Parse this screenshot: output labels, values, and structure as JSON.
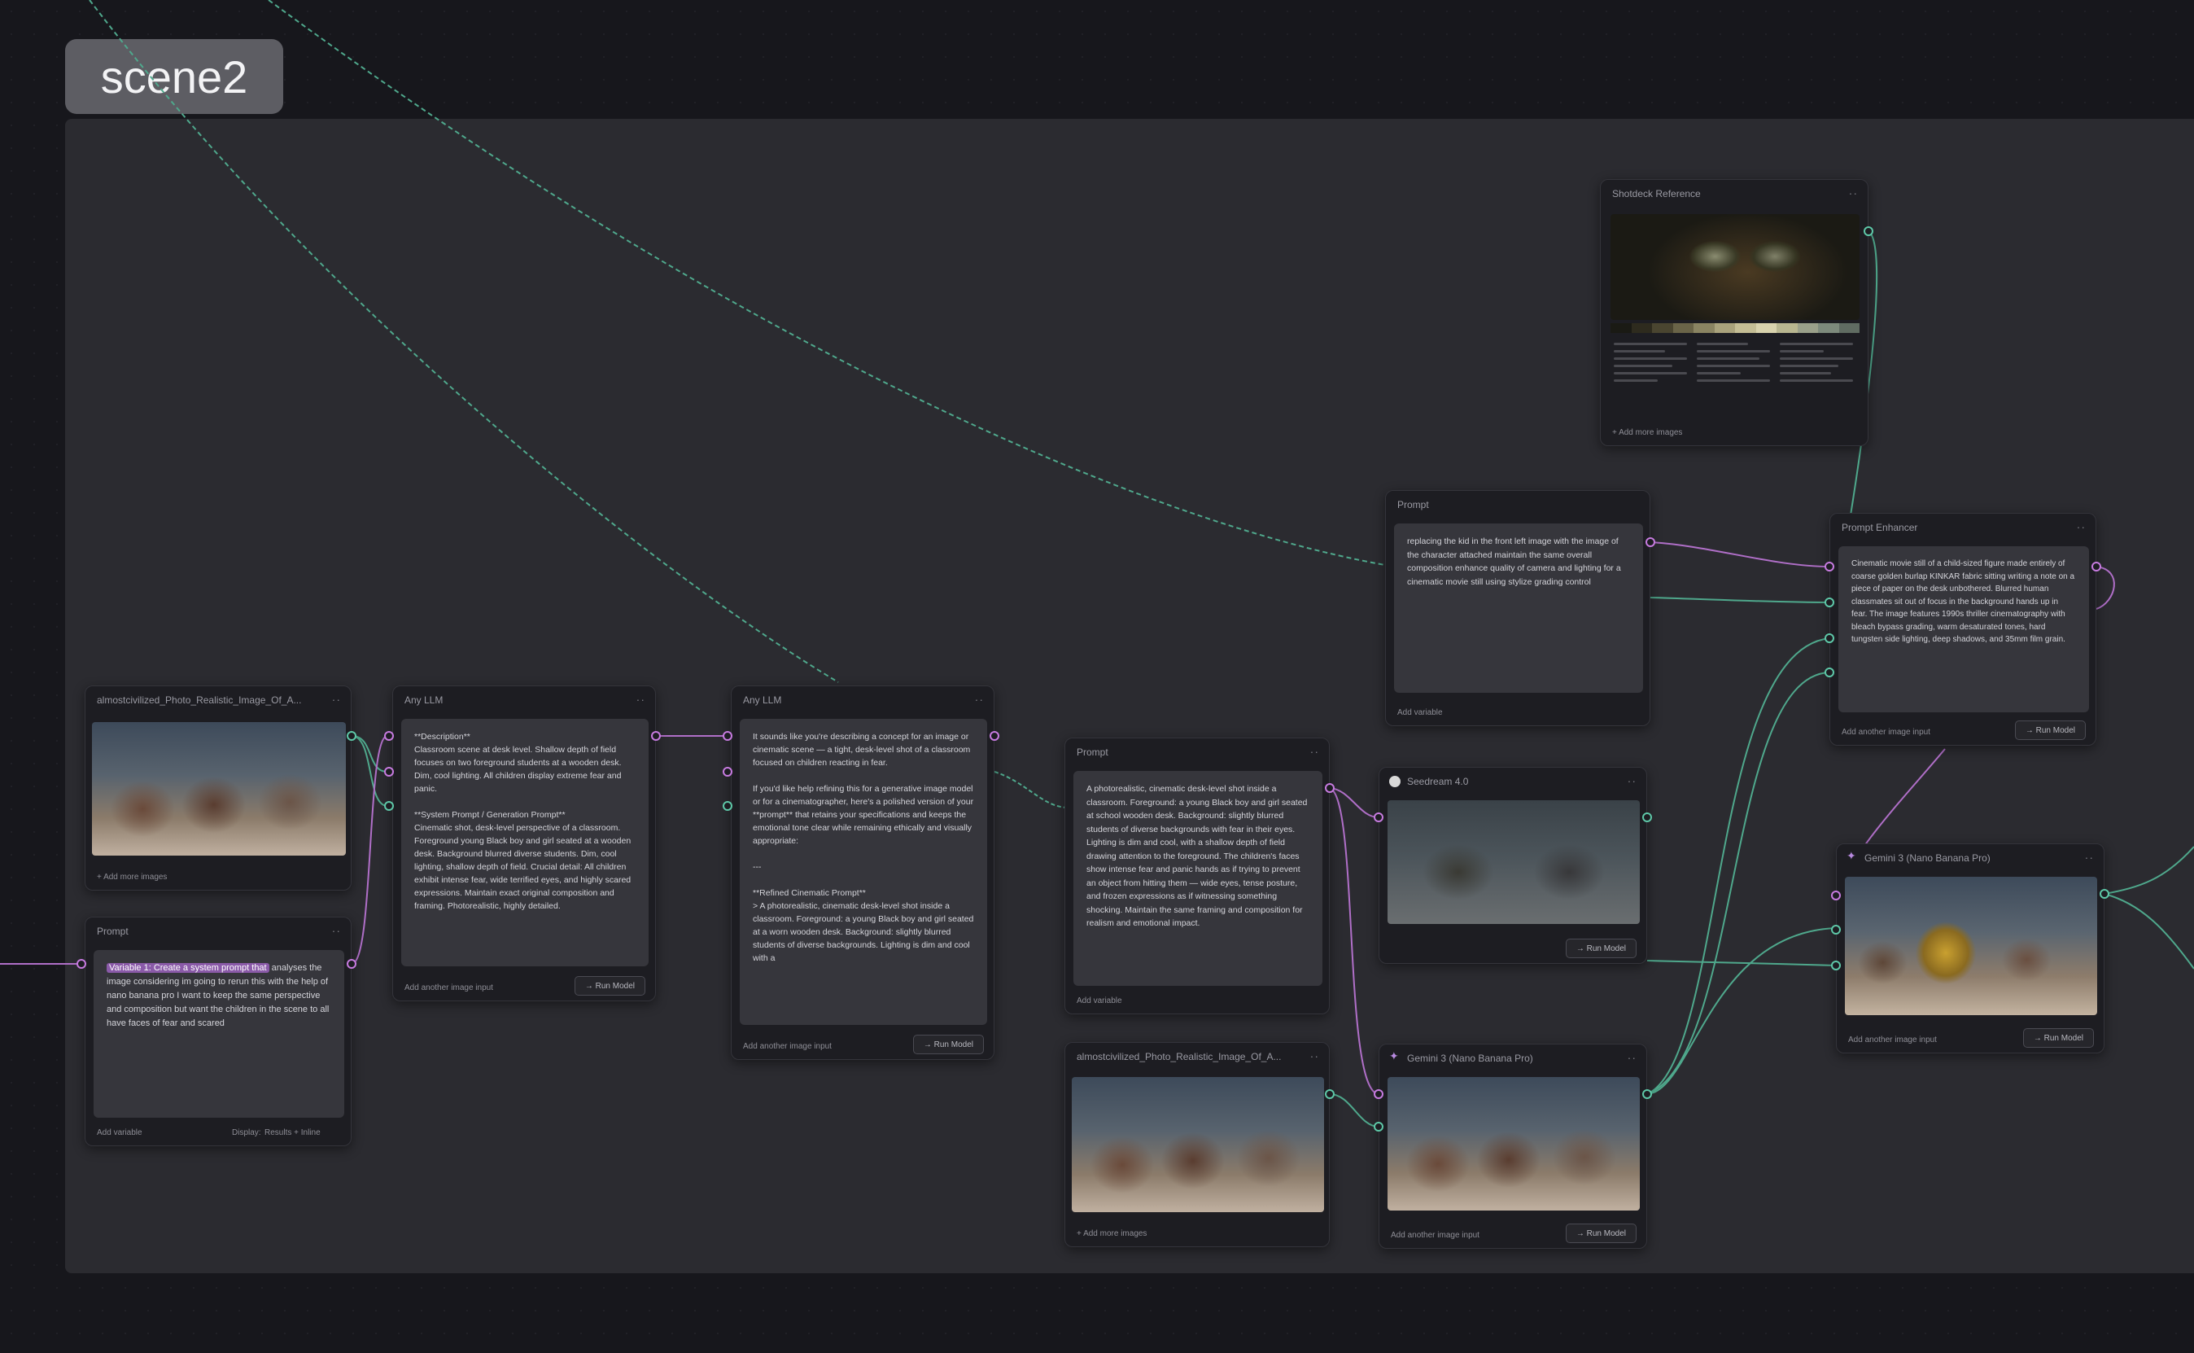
{
  "group": {
    "label": "scene2"
  },
  "nodes": {
    "image_input_1": {
      "title": "almostcivilized_Photo_Realistic_Image_Of_A...",
      "footer": "+ Add more images"
    },
    "prompt_1": {
      "title": "Prompt",
      "highlight": "Variable 1: Create a system prompt that",
      "text": " analyses the image considering im going to rerun this with the help of nano banana pro I want to keep the same perspective and composition but want the children in the scene to all have faces of fear and scared",
      "footer": "Add variable",
      "display_label": "Display:",
      "display_value": "Results + Inline"
    },
    "any_llm_1": {
      "title": "Any LLM",
      "text": "**Description**\nClassroom scene at desk level. Shallow depth of field focuses on two foreground students at a wooden desk. Dim, cool lighting. All children display extreme fear and panic.\n\n**System Prompt / Generation Prompt**\nCinematic shot, desk-level perspective of a classroom. Foreground young Black boy and girl seated at a wooden desk. Background blurred diverse students. Dim, cool lighting, shallow depth of field. Crucial detail: All children exhibit intense fear, wide terrified eyes, and highly scared expressions. Maintain exact original composition and framing. Photorealistic, highly detailed.",
      "footer": "Add another image input",
      "run": "→ Run Model"
    },
    "any_llm_2": {
      "title": "Any LLM",
      "text": "It sounds like you're describing a concept for an image or cinematic scene — a tight, desk-level shot of a classroom focused on children reacting in fear.\n\nIf you'd like help refining this for a generative image model or for a cinematographer, here's a polished version of your **prompt** that retains your specifications and keeps the emotional tone clear while remaining ethically and visually appropriate:\n\n---\n\n**Refined Cinematic Prompt**\n> A photorealistic, cinematic desk-level shot inside a classroom. Foreground: a young Black boy and girl seated at a worn wooden desk. Background: slightly blurred students of diverse backgrounds. Lighting is dim and cool with a",
      "footer": "Add another image input",
      "run": "→ Run Model"
    },
    "prompt_2": {
      "title": "Prompt",
      "text": "A photorealistic, cinematic desk-level shot inside a classroom. Foreground: a young Black boy and girl seated at school wooden desk. Background: slightly blurred students of diverse backgrounds with fear in their eyes. Lighting is dim and cool, with a shallow depth of field drawing attention to the foreground. The children's faces show intense fear and panic hands as if trying to prevent an object from hitting them — wide eyes, tense posture, and frozen expressions as if witnessing something shocking. Maintain the same framing and composition for realism and emotional impact.",
      "footer": "Add variable"
    },
    "image_input_2": {
      "title": "almostcivilized_Photo_Realistic_Image_Of_A...",
      "footer": "+ Add more images"
    },
    "seedream": {
      "title": "Seedream 4.0",
      "run": "→ Run Model"
    },
    "gemini_1": {
      "title": "Gemini 3 (Nano Banana Pro)",
      "footer": "Add another image input",
      "run": "→ Run Model"
    },
    "prompt_3": {
      "title": "Prompt",
      "text": "replacing the kid in the front left image with the image of the character attached maintain the same overall composition enhance quality of camera and lighting for a cinematic movie still using stylize grading control",
      "footer": "Add variable"
    },
    "shotdeck": {
      "title": "Shotdeck Reference",
      "footer": "+ Add more images",
      "palette": [
        "#1a1a14",
        "#2e2b1e",
        "#4a4530",
        "#6a6448",
        "#8a8462",
        "#a9a27c",
        "#c4bd95",
        "#d8d2ad",
        "#b8b690",
        "#9aa08a",
        "#7d8a7c",
        "#606c62"
      ]
    },
    "prompt_enhancer": {
      "title": "Prompt Enhancer",
      "text": "Cinematic movie still of a child-sized figure made entirely of coarse golden burlap KINKAR fabric sitting writing a note on a piece of paper on the desk unbothered. Blurred human classmates sit out of focus in the background hands up in fear. The image features 1990s thriller cinematography with bleach bypass grading, warm desaturated tones, hard tungsten side lighting, deep shadows, and 35mm film grain.",
      "footer": "Add another image input",
      "run": "→ Run Model"
    },
    "gemini_2": {
      "title": "Gemini 3 (Nano Banana Pro)",
      "footer": "Add another image input",
      "run": "→ Run Model"
    }
  }
}
